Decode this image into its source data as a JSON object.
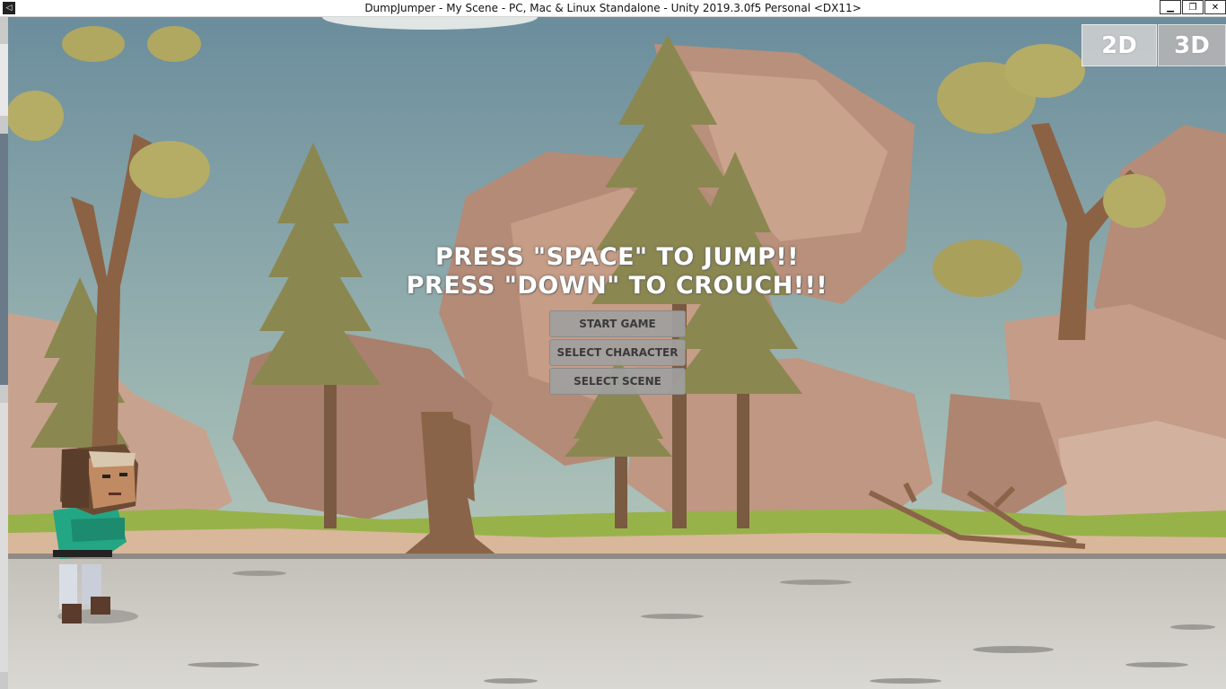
{
  "window": {
    "title": "DumpJumper - My Scene - PC, Mac & Linux Standalone - Unity 2019.3.0f5 Personal <DX11>",
    "controls": {
      "minimize": "▁",
      "maximize": "❐",
      "close": "✕"
    }
  },
  "game": {
    "instructions": [
      "Press \"SPACE\" to JUMP!!",
      "Press \"DOWN\" to CROUCH!!!"
    ],
    "menu": {
      "start_label": "Start Game",
      "character_label": "Select Character",
      "scene_label": "Select  Scene"
    },
    "view_modes": {
      "two_d": "2D",
      "three_d": "3D"
    }
  },
  "colors": {
    "sky_top": "#6f8f9f",
    "sky_bottom": "#b9c8bf",
    "rock": "#b8917a",
    "tree": "#8f8a52",
    "grass": "#9bb448",
    "ground": "#c9c7c0",
    "shirt": "#23a684"
  }
}
